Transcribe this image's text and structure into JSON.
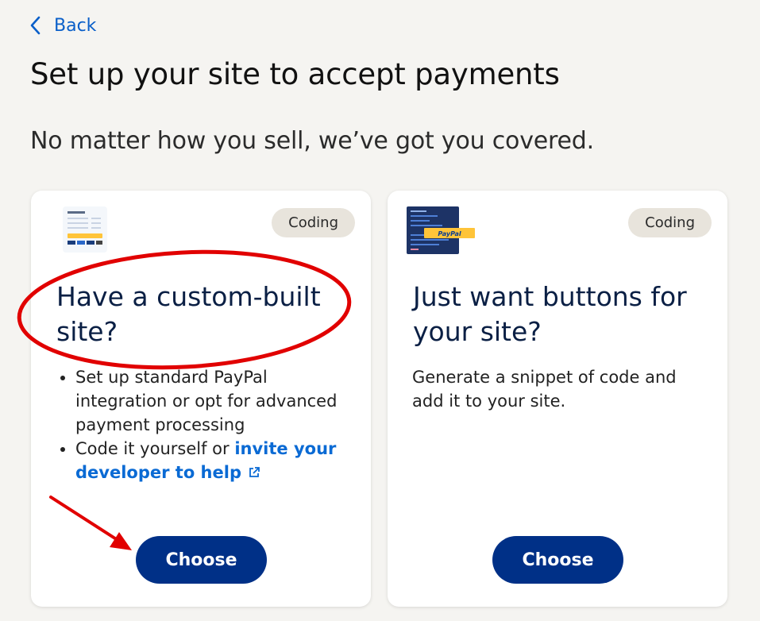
{
  "nav": {
    "back_label": "Back"
  },
  "page": {
    "title": "Set up your site to accept payments",
    "subtitle": "No matter how you sell, we’ve got you covered."
  },
  "cards": [
    {
      "badge": "Coding",
      "title": "Have a custom-built site?",
      "bullets": {
        "b1": "Set up standard PayPal integration or opt for advanced payment processing",
        "b2_prefix": "Code it yourself or ",
        "b2_link": "invite your developer to help"
      },
      "button_label": "Choose"
    },
    {
      "badge": "Coding",
      "title": "Just want buttons for your site?",
      "thumb_logo": "PayPal",
      "description": "Generate a snippet of code and add it to your site.",
      "button_label": "Choose"
    }
  ],
  "colors": {
    "background": "#f5f4f1",
    "link": "#0a6ad4",
    "button": "#003087",
    "badge_bg": "#e8e4dc",
    "annotation": "#e10000"
  },
  "icons": [
    "chevron-left-icon",
    "external-link-icon"
  ]
}
